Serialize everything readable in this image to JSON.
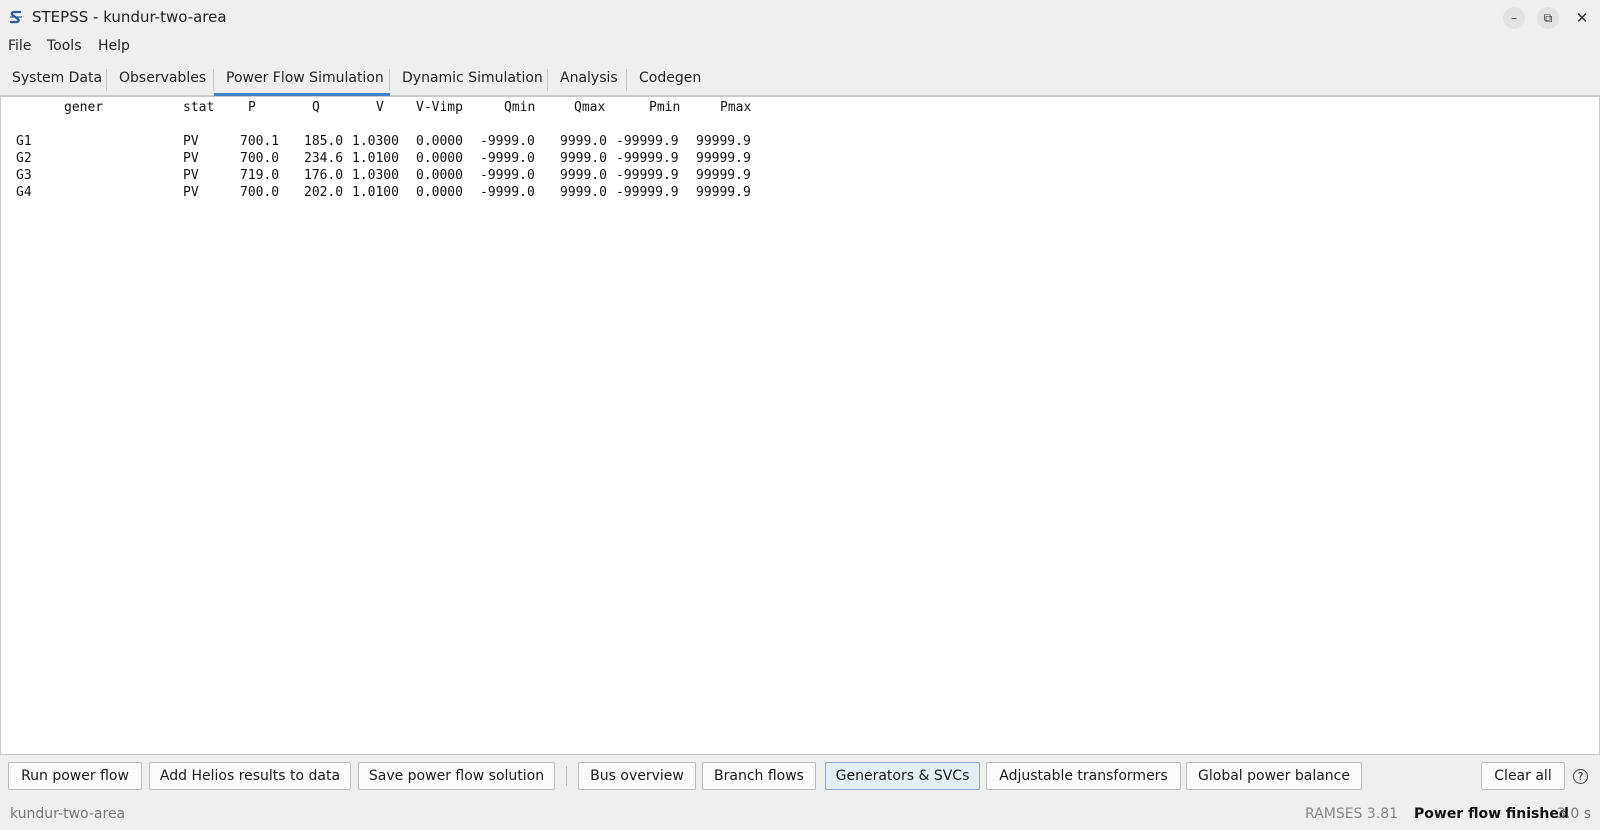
{
  "window": {
    "title": "STEPSS - kundur-two-area",
    "minimize_glyph": "–",
    "maximize_glyph": "⧉",
    "close_glyph": "✕"
  },
  "menu": [
    "File",
    "Tools",
    "Help"
  ],
  "tabs": [
    {
      "label": "System Data"
    },
    {
      "label": "Observables"
    },
    {
      "label": "Power Flow Simulation",
      "active": true
    },
    {
      "label": "Dynamic Simulation"
    },
    {
      "label": "Analysis"
    },
    {
      "label": "Codegen"
    }
  ],
  "output": {
    "columns": [
      "gener",
      "stat",
      "P",
      "Q",
      "V",
      "V-Vimp",
      "Qmin",
      "Qmax",
      "Pmin",
      "Pmax"
    ],
    "rows": [
      [
        "G1",
        "PV",
        "700.1",
        "185.0",
        "1.0300",
        "0.0000",
        "-9999.0",
        "9999.0",
        "-99999.9",
        "99999.9"
      ],
      [
        "G2",
        "PV",
        "700.0",
        "234.6",
        "1.0100",
        "0.0000",
        "-9999.0",
        "9999.0",
        "-99999.9",
        "99999.9"
      ],
      [
        "G3",
        "PV",
        "719.0",
        "176.0",
        "1.0300",
        "0.0000",
        "-9999.0",
        "9999.0",
        "-99999.9",
        "99999.9"
      ],
      [
        "G4",
        "PV",
        "700.0",
        "202.0",
        "1.0100",
        "0.0000",
        "-9999.0",
        "9999.0",
        "-99999.9",
        "99999.9"
      ]
    ]
  },
  "toolbar": {
    "run": "Run power flow",
    "add_helios": "Add Helios results to data",
    "save": "Save power flow solution",
    "bus_overview": "Bus overview",
    "branch_flows": "Branch flows",
    "generators_svcs": "Generators & SVCs",
    "adjustable_transformers": "Adjustable transformers",
    "global_balance": "Global power balance",
    "clear_all": "Clear all",
    "help_glyph": "?"
  },
  "status": {
    "project": "kundur-two-area",
    "version": "RAMSES 3.81",
    "message": "Power flow finished",
    "time": "3.0 s"
  },
  "colors": {
    "accent": "#3d84c6",
    "background": "#efefef",
    "output_bg": "#ffffff"
  }
}
